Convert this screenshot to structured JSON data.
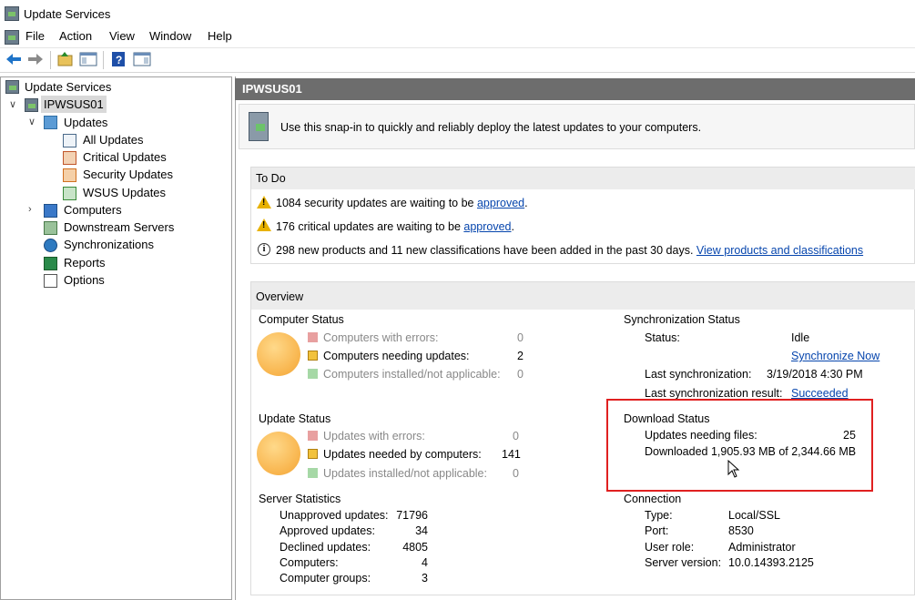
{
  "window": {
    "title": "Update Services"
  },
  "menu": [
    "File",
    "Action",
    "View",
    "Window",
    "Help"
  ],
  "tree": {
    "root": "Update Services",
    "server": "IPWSUS01",
    "updates": "Updates",
    "all_updates": "All Updates",
    "critical_updates": "Critical Updates",
    "security_updates": "Security Updates",
    "wsus_updates": "WSUS Updates",
    "computers": "Computers",
    "downstream": "Downstream Servers",
    "sync": "Synchronizations",
    "reports": "Reports",
    "options": "Options"
  },
  "header": {
    "title": "IPWSUS01"
  },
  "intro": "Use this snap-in to quickly and reliably deploy the latest updates to your computers.",
  "todo": {
    "title": "To Do",
    "item1_text": "1084 security updates are waiting to be ",
    "item1_link": "approved",
    "item1_end": ".",
    "item2_text": "176 critical updates are waiting to be ",
    "item2_link": "approved",
    "item2_end": ".",
    "item3_text": "298 new products and 11 new classifications have been added in the past 30 days.",
    "item3_link": "View products and classifications"
  },
  "overview": {
    "title": "Overview",
    "computer_status": {
      "title": "Computer Status",
      "rows": [
        {
          "label": "Computers with errors:",
          "value": "0"
        },
        {
          "label": "Computers needing updates:",
          "value": "2"
        },
        {
          "label": "Computers installed/not applicable:",
          "value": "0"
        }
      ]
    },
    "update_status": {
      "title": "Update Status",
      "rows": [
        {
          "label": "Updates with errors:",
          "value": "0"
        },
        {
          "label": "Updates needed by computers:",
          "value": "141"
        },
        {
          "label": "Updates installed/not applicable:",
          "value": "0"
        }
      ]
    },
    "server_stats": {
      "title": "Server Statistics",
      "rows": [
        {
          "label": "Unapproved updates:",
          "value": "71796"
        },
        {
          "label": "Approved updates:",
          "value": "34"
        },
        {
          "label": "Declined updates:",
          "value": "4805"
        },
        {
          "label": "Computers:",
          "value": "4"
        },
        {
          "label": "Computer groups:",
          "value": "3"
        }
      ]
    },
    "sync_status": {
      "title": "Synchronization Status",
      "status_label": "Status:",
      "status_value": "Idle",
      "sync_now": "Synchronize Now",
      "last_sync_label": "Last synchronization:",
      "last_sync_value": "3/19/2018 4:30 PM",
      "last_result_label": "Last synchronization result:",
      "last_result_value": "Succeeded"
    },
    "download_status": {
      "title": "Download Status",
      "needing_label": "Updates needing files:",
      "needing_value": "25",
      "downloaded_text": "Downloaded 1,905.93 MB of 2,344.66 MB"
    },
    "connection": {
      "title": "Connection",
      "rows": [
        {
          "label": "Type:",
          "value": "Local/SSL"
        },
        {
          "label": "Port:",
          "value": "8530"
        },
        {
          "label": "User role:",
          "value": "Administrator"
        },
        {
          "label": "Server version:",
          "value": "10.0.14393.2125"
        }
      ]
    }
  },
  "colors": {
    "error": "#e8a0a0",
    "needed": "#f2c23c",
    "installed": "#a6d8a6",
    "accent_red": "#e02020",
    "header_gray": "#6d6d6d"
  }
}
